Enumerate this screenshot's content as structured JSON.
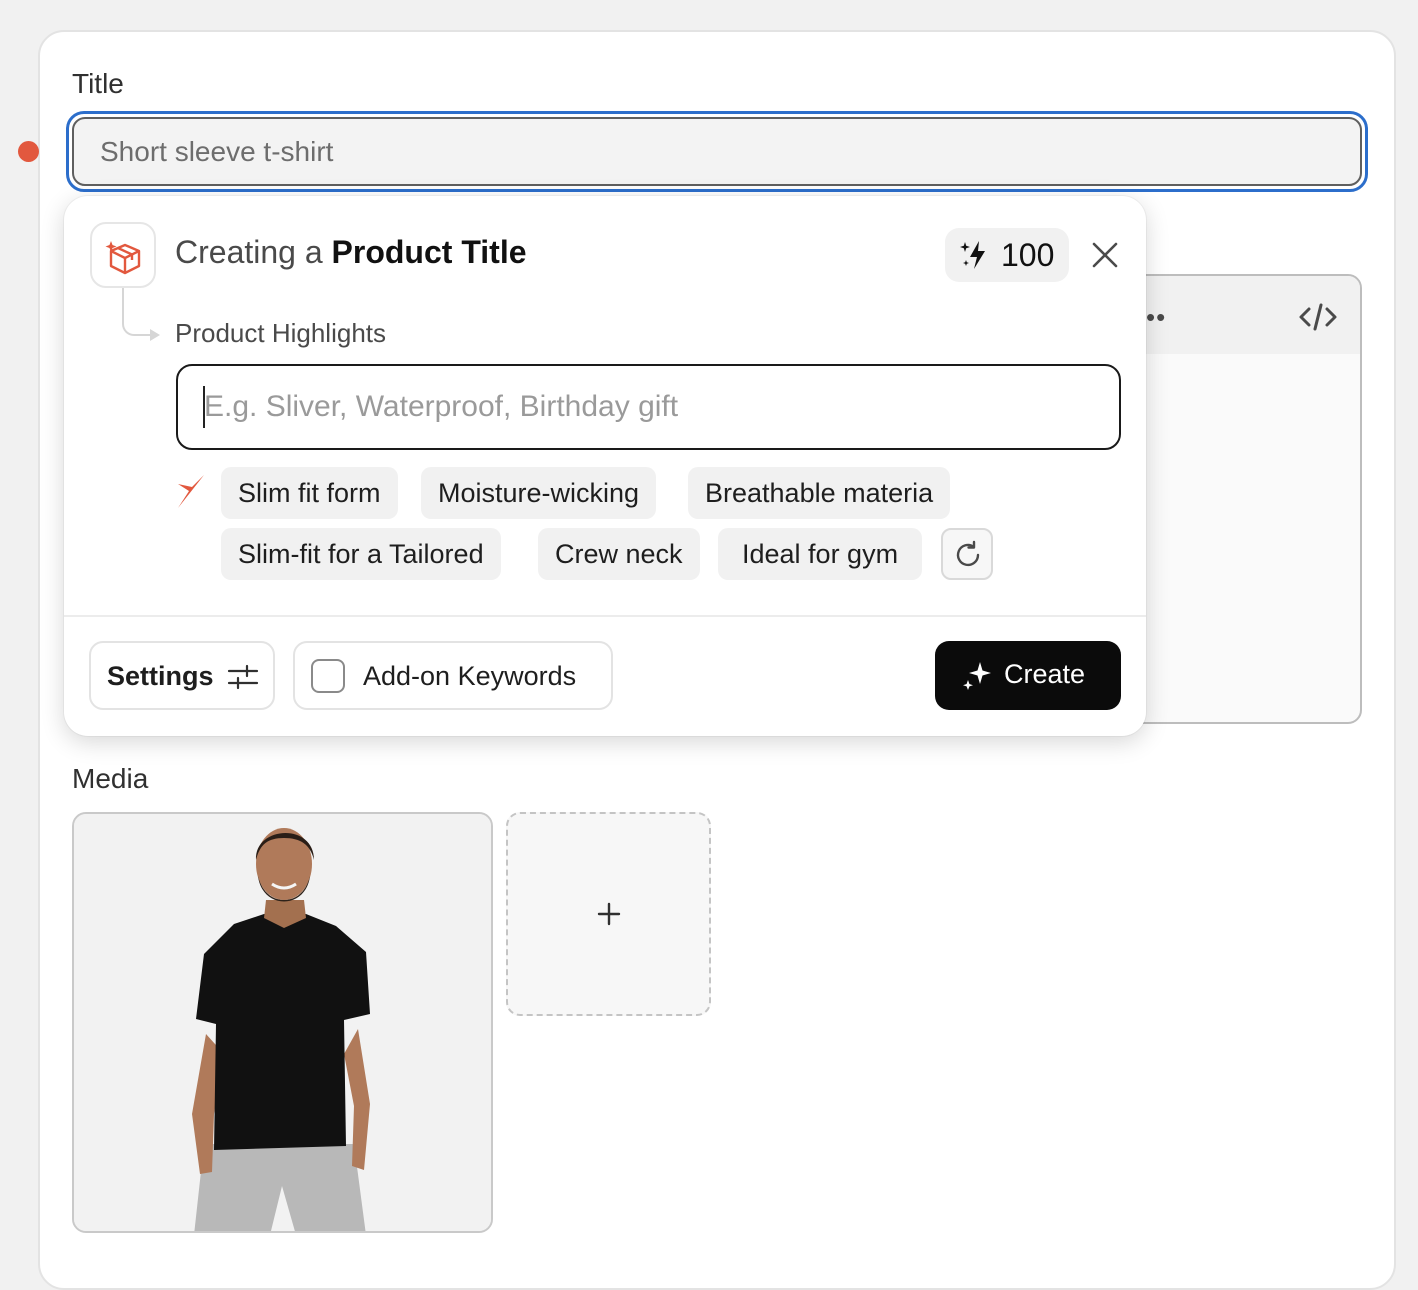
{
  "title_field": {
    "label": "Title",
    "value": "Short sleeve t-shirt"
  },
  "editor": {
    "more_icon": "more-dots-icon",
    "code_icon": "code-icon"
  },
  "popup": {
    "heading_prefix": "Creating a ",
    "heading_strong": "Product Title",
    "credits": "100",
    "highlights_label": "Product Highlights",
    "highlights_placeholder": "E.g. Sliver, Waterproof, Birthday gift",
    "suggestions": [
      "Slim fit form",
      "Moisture-wicking",
      "Breathable materia",
      "Slim-fit for a Tailored",
      "Crew neck",
      "Ideal for gym"
    ],
    "settings_label": "Settings",
    "addon_label": "Add-on Keywords",
    "addon_checked": false,
    "create_label": "Create"
  },
  "media": {
    "label": "Media",
    "add_symbol": "+"
  },
  "colors": {
    "accent": "#e2583e",
    "focus": "#2c6ecb",
    "primary_button": "#0b0b0b"
  }
}
